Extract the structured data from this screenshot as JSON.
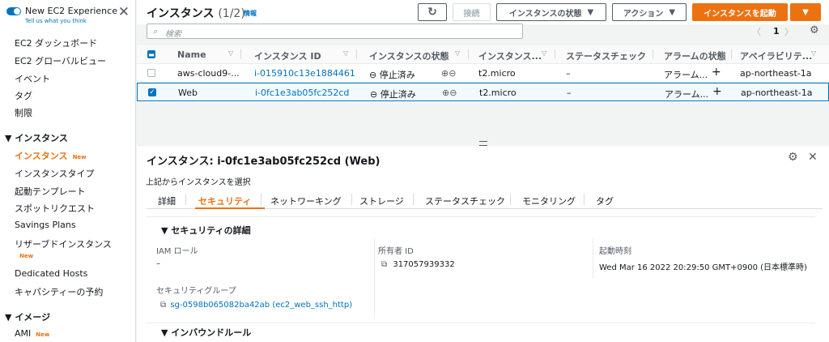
{
  "sidebar": {
    "experience_title": "New EC2 Experience",
    "experience_sub": "Tell us what you think",
    "items": [
      {
        "label": "EC2 ダッシュボード"
      },
      {
        "label": "EC2 グローバルビュー"
      },
      {
        "label": "イベント"
      },
      {
        "label": "タグ"
      },
      {
        "label": "制限"
      }
    ],
    "section_instances": "インスタンス",
    "instance_items": [
      {
        "label": "インスタンス",
        "badge": "New"
      },
      {
        "label": "インスタンスタイプ"
      },
      {
        "label": "起動テンプレート"
      },
      {
        "label": "スポットリクエスト"
      },
      {
        "label": "Savings Plans"
      },
      {
        "label": "リザーブドインスタンス",
        "badge": "New"
      },
      {
        "label": "Dedicated Hosts"
      },
      {
        "label": "キャパシティーの予約"
      }
    ],
    "section_images": "イメージ",
    "image_items": [
      {
        "label": "AMI",
        "badge": "New"
      }
    ]
  },
  "toolbar": {
    "title": "インスタンス",
    "count": "(1/2)",
    "info": "情報",
    "connect": "接続",
    "state": "インスタンスの状態",
    "actions": "アクション",
    "launch": "インスタンスを起動"
  },
  "search": {
    "placeholder": "検索"
  },
  "pager": {
    "page": "1"
  },
  "table": {
    "columns": [
      "Name",
      "インスタンス ID",
      "インスタンスの状態",
      "インスタンス...",
      "ステータスチェック",
      "アラームの状態",
      "アベイラビリテ..."
    ],
    "rows": [
      {
        "name": "aws-cloud9-...",
        "id": "i-015910c13e1884461",
        "state": "停止済み",
        "type": "t2.micro",
        "status": "–",
        "alarm": "アラーム...",
        "az": "ap-northeast-1a",
        "selected": false
      },
      {
        "name": "Web",
        "id": "i-0fc1e3ab05fc252cd",
        "state": "停止済み",
        "type": "t2.micro",
        "status": "–",
        "alarm": "アラーム...",
        "az": "ap-northeast-1a",
        "selected": true
      }
    ]
  },
  "detail": {
    "title": "インスタンス: i-0fc1e3ab05fc252cd (Web)",
    "subtitle": "上記からインスタンスを選択",
    "tabs": [
      "詳細",
      "セキュリティ",
      "ネットワーキング",
      "ストレージ",
      "ステータスチェック",
      "モニタリング",
      "タグ"
    ],
    "active_tab": "セキュリティ",
    "section_security": "セキュリティの詳細",
    "iam_label": "IAM ロール",
    "iam_value": "–",
    "owner_label": "所有者 ID",
    "owner_value": "317057939332",
    "launch_label": "起動時刻",
    "launch_value": "Wed Mar 16 2022 20:29:50 GMT+0900 (日本標準時)",
    "sg_label": "セキュリティグループ",
    "sg_value": "sg-0598b065082ba42ab (ec2_web_ssh_http)",
    "section_inbound": "インバウンドルール"
  },
  "colors": {
    "accent": "#ec7211",
    "link": "#0073bb"
  }
}
